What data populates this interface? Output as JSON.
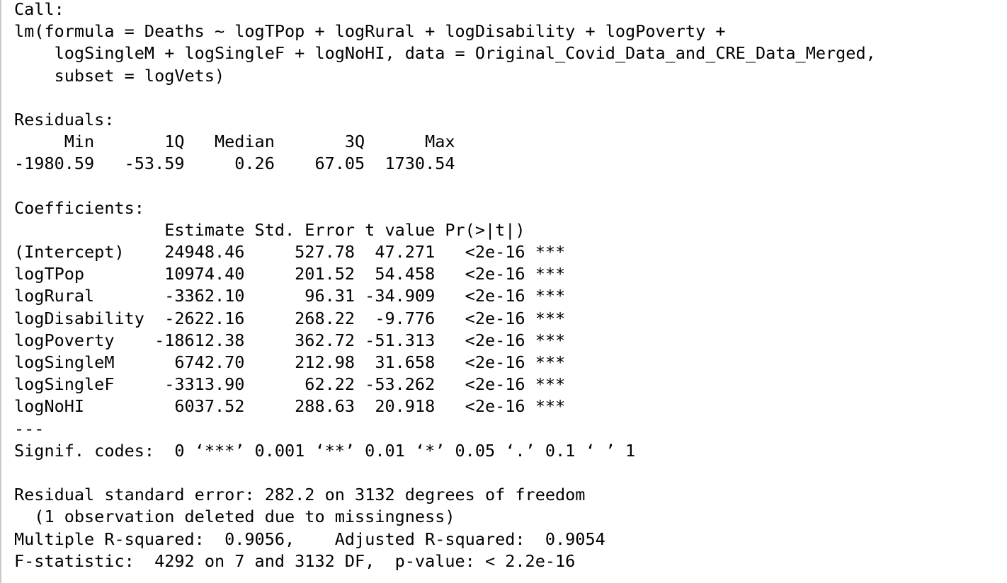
{
  "console": {
    "lines": [
      "Call:",
      "lm(formula = Deaths ~ logTPop + logRural + logDisability + logPoverty +",
      "    logSingleM + logSingleF + logNoHI, data = Original_Covid_Data_and_CRE_Data_Merged,",
      "    subset = logVets)",
      "",
      "Residuals:",
      "     Min       1Q   Median       3Q      Max ",
      "-1980.59   -53.59     0.26    67.05  1730.54 ",
      "",
      "Coefficients:",
      "               Estimate Std. Error t value Pr(>|t|)    ",
      "(Intercept)    24948.46     527.78  47.271   <2e-16 ***",
      "logTPop        10974.40     201.52  54.458   <2e-16 ***",
      "logRural       -3362.10      96.31 -34.909   <2e-16 ***",
      "logDisability  -2622.16     268.22  -9.776   <2e-16 ***",
      "logPoverty    -18612.38     362.72 -51.313   <2e-16 ***",
      "logSingleM      6742.70     212.98  31.658   <2e-16 ***",
      "logSingleF     -3313.90      62.22 -53.262   <2e-16 ***",
      "logNoHI         6037.52     288.63  20.918   <2e-16 ***",
      "---",
      "Signif. codes:  0 ‘***’ 0.001 ‘**’ 0.01 ‘*’ 0.05 ‘.’ 0.1 ‘ ’ 1",
      "",
      "Residual standard error: 282.2 on 3132 degrees of freedom",
      "  (1 observation deleted due to missingness)",
      "Multiple R-squared:  0.9056,\tAdjusted R-squared:  0.9054 ",
      "F-statistic:  4292 on 7 and 3132 DF,  p-value: < 2.2e-16"
    ]
  }
}
